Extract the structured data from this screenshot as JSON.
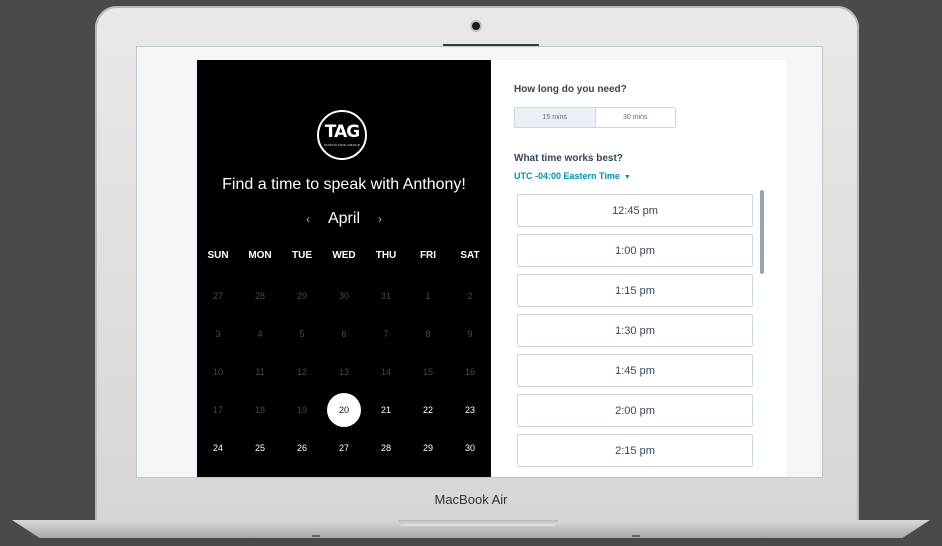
{
  "device": {
    "model": "MacBook Air"
  },
  "calendar": {
    "logo_text": "TAG",
    "logo_subtext": "CONSULTING GROUP",
    "headline": "Find a time to speak with Anthony!",
    "month": "April",
    "prev_arrow": "‹",
    "next_arrow": "›",
    "weekdays": [
      "SUN",
      "MON",
      "TUE",
      "WED",
      "THU",
      "FRI",
      "SAT"
    ],
    "weeks": [
      [
        "27",
        "28",
        "29",
        "30",
        "31",
        "1",
        "2"
      ],
      [
        "3",
        "4",
        "5",
        "6",
        "7",
        "8",
        "9"
      ],
      [
        "10",
        "11",
        "12",
        "13",
        "14",
        "15",
        "16"
      ],
      [
        "17",
        "18",
        "19",
        "20",
        "21",
        "22",
        "23"
      ],
      [
        "24",
        "25",
        "26",
        "27",
        "28",
        "29",
        "30"
      ]
    ],
    "selected_day": "20"
  },
  "booking": {
    "duration_question": "How long do you need?",
    "durations": [
      "15 mins",
      "30 mins"
    ],
    "selected_duration": "15 mins",
    "time_question": "What time works best?",
    "timezone": "UTC -04:00 Eastern Time",
    "slots": [
      "12:45 pm",
      "1:00 pm",
      "1:15 pm",
      "1:30 pm",
      "1:45 pm",
      "2:00 pm",
      "2:15 pm"
    ]
  },
  "colors": {
    "calendar_bg": "#000000",
    "accent": "#0091ae",
    "text_dark": "#33475b"
  }
}
